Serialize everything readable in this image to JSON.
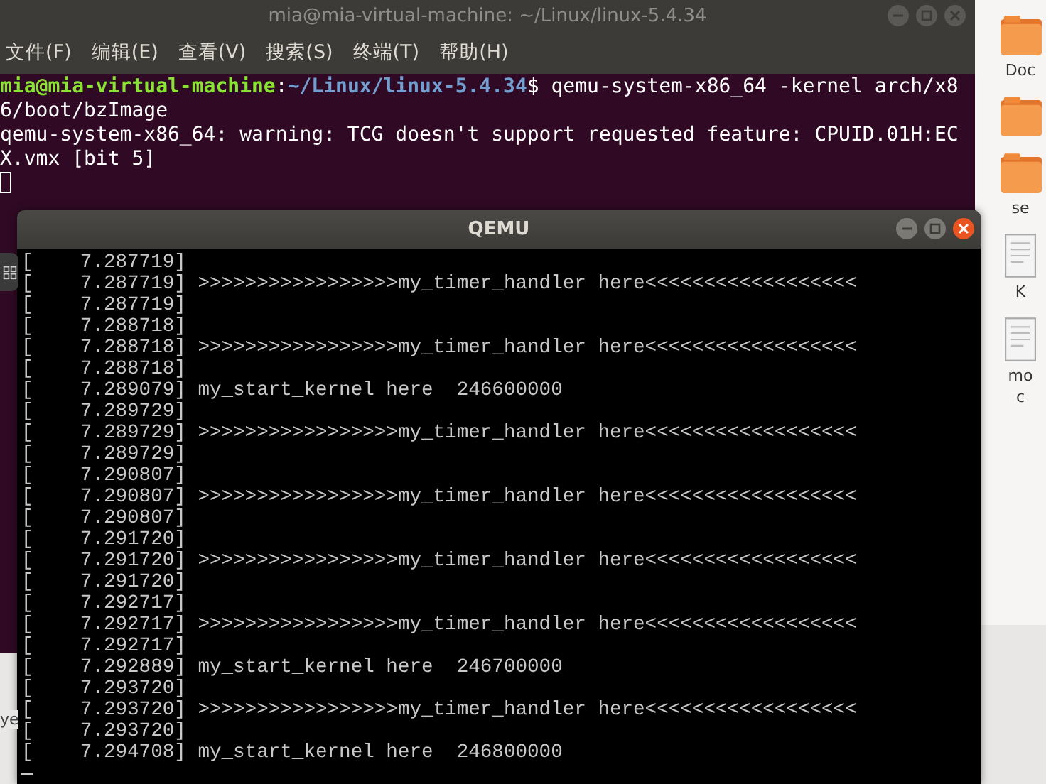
{
  "terminal": {
    "title": "mia@mia-virtual-machine: ~/Linux/linux-5.4.34",
    "menu": [
      "文件(F)",
      "编辑(E)",
      "查看(V)",
      "搜索(S)",
      "终端(T)",
      "帮助(H)"
    ],
    "prompt": {
      "user": "mia@mia-virtual-machine",
      "separator": ":",
      "path": "~/Linux/linux-5.4.34",
      "command": "$ qemu-system-x86_64 -kernel arch/x8"
    },
    "output": [
      "6/boot/bzImage",
      "qemu-system-x86_64: warning: TCG doesn't support requested feature: CPUID.01H:EC",
      "X.vmx [bit 5]"
    ]
  },
  "files": [
    {
      "kind": "folder",
      "label": "Doc"
    },
    {
      "kind": "folder"
    },
    {
      "kind": "folder",
      "label": "se"
    },
    {
      "kind": "document",
      "label": "K"
    },
    {
      "kind": "document",
      "label": "mo\nc"
    }
  ],
  "desktop_text": "ye",
  "qemu": {
    "title": "QEMU",
    "lines": [
      "[    7.287719]",
      "[    7.287719] >>>>>>>>>>>>>>>>>my_timer_handler here<<<<<<<<<<<<<<<<<<",
      "[    7.287719]",
      "[    7.288718]",
      "[    7.288718] >>>>>>>>>>>>>>>>>my_timer_handler here<<<<<<<<<<<<<<<<<<",
      "[    7.288718]",
      "[    7.289079] my_start_kernel here  246600000",
      "[    7.289729]",
      "[    7.289729] >>>>>>>>>>>>>>>>>my_timer_handler here<<<<<<<<<<<<<<<<<<",
      "[    7.289729]",
      "[    7.290807]",
      "[    7.290807] >>>>>>>>>>>>>>>>>my_timer_handler here<<<<<<<<<<<<<<<<<<",
      "[    7.290807]",
      "[    7.291720]",
      "[    7.291720] >>>>>>>>>>>>>>>>>my_timer_handler here<<<<<<<<<<<<<<<<<<",
      "[    7.291720]",
      "[    7.292717]",
      "[    7.292717] >>>>>>>>>>>>>>>>>my_timer_handler here<<<<<<<<<<<<<<<<<<",
      "[    7.292717]",
      "[    7.292889] my_start_kernel here  246700000",
      "[    7.293720]",
      "[    7.293720] >>>>>>>>>>>>>>>>>my_timer_handler here<<<<<<<<<<<<<<<<<<",
      "[    7.293720]",
      "[    7.294708] my_start_kernel here  246800000"
    ]
  }
}
